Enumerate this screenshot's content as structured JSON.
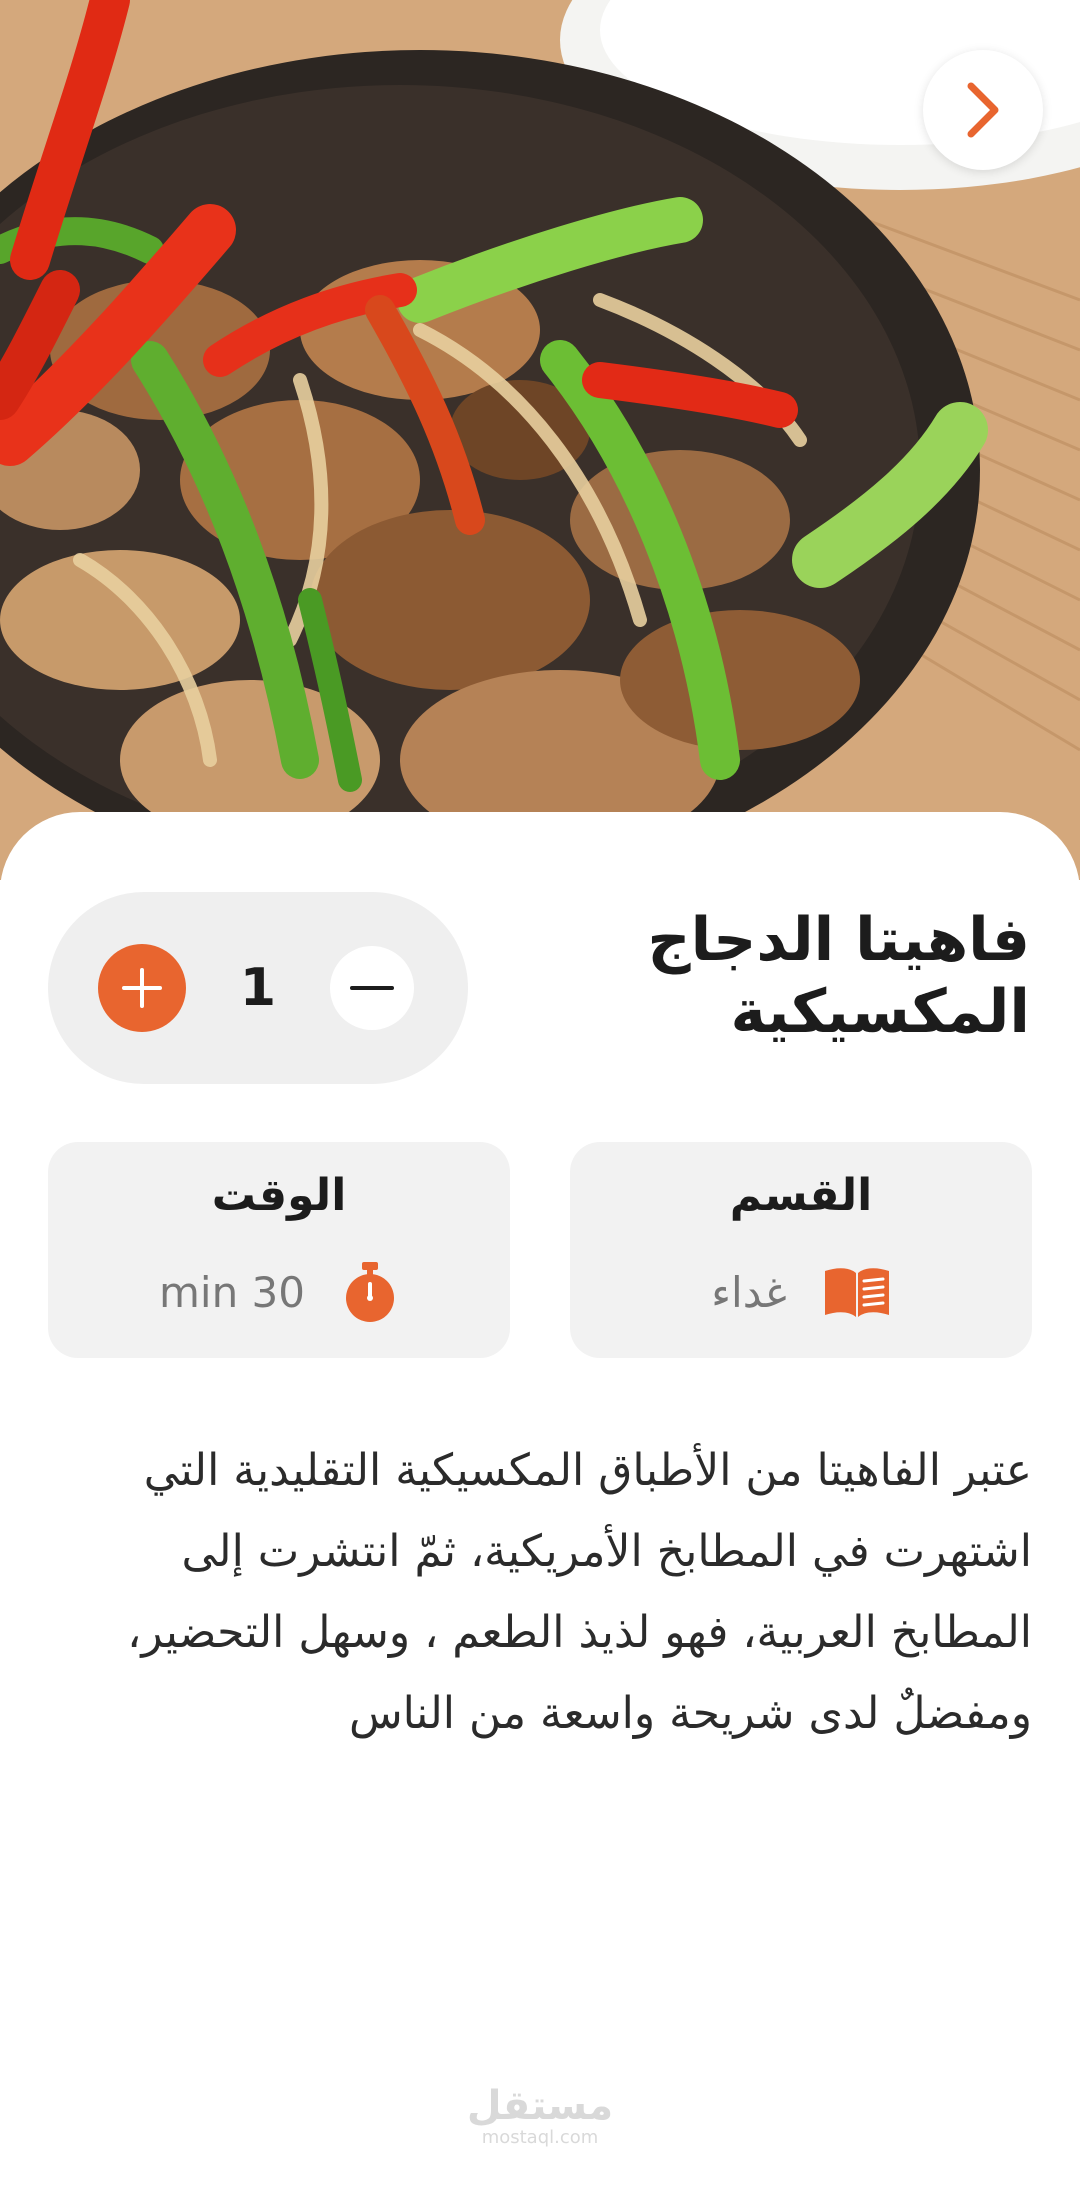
{
  "hero": {
    "image_alt": "",
    "back_icon": "chevron-right-icon"
  },
  "recipe": {
    "title": "فاهيتا الدجاج المكسيكية",
    "quantity": "1",
    "category_label": "القسم",
    "category_value": "غداء",
    "category_icon": "open-book-icon",
    "time_label": "الوقت",
    "time_value": "min 30",
    "time_icon": "stopwatch-icon",
    "description": "عتبر الفاهيتا من الأطباق المكسيكية التقليدية التي اشتهرت في المطابخ الأمريكية، ثمّ انتشرت إلى المطابخ العربية، فهو لذيذ الطعم ، وسهل التحضير، ومفضلٌ لدى شريحة واسعة من الناس"
  },
  "watermark": {
    "main": "مستقل",
    "sub": "mostaql.com"
  },
  "colors": {
    "accent": "#e8652f",
    "card_bg": "#f2f2f2",
    "text": "#1c1c1c",
    "muted": "#777777"
  }
}
